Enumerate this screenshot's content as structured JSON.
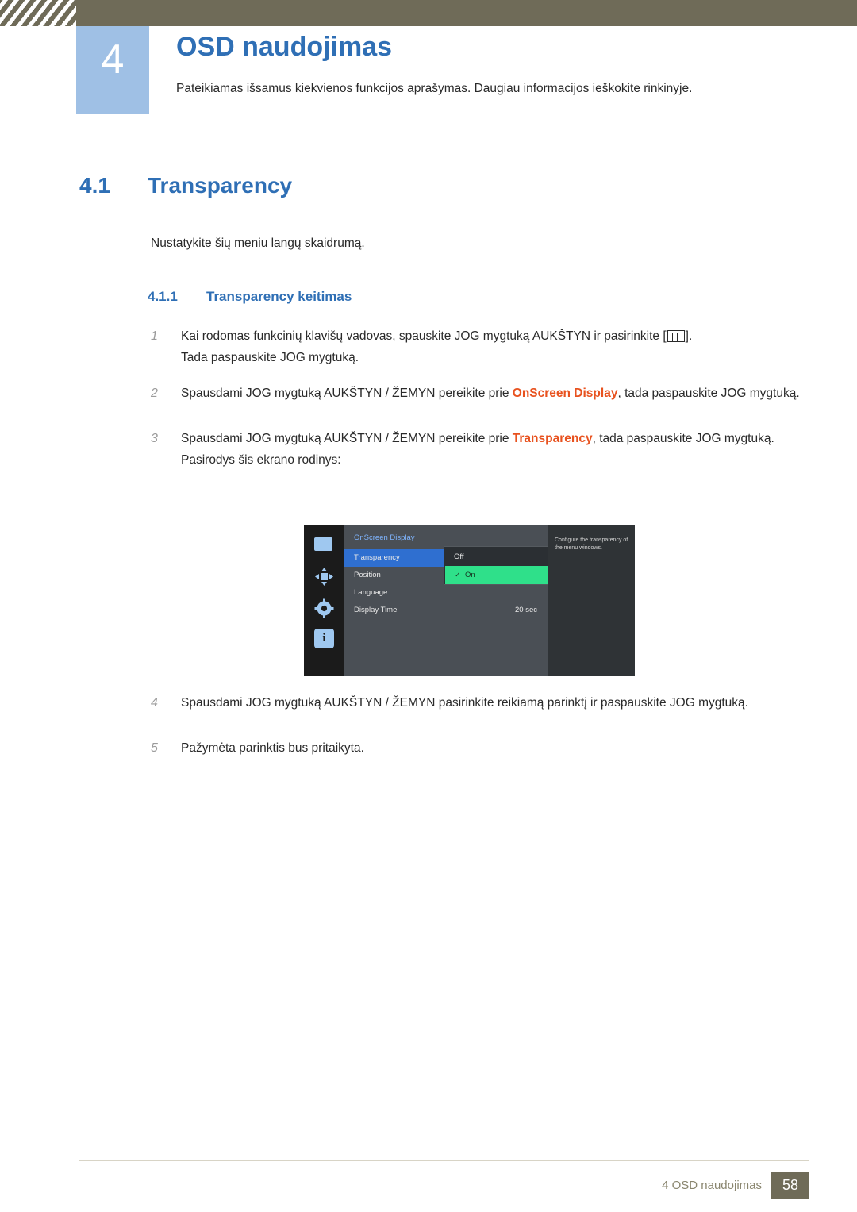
{
  "header": {
    "chapter_number": "4",
    "title": "OSD naudojimas",
    "subtitle": "Pateikiamas išsamus kiekvienos funkcijos aprašymas. Daugiau informacijos ieškokite rinkinyje."
  },
  "section": {
    "number": "4.1",
    "title": "Transparency",
    "intro": "Nustatykite šių meniu langų skaidrumą."
  },
  "subsection": {
    "number": "4.1.1",
    "title": "Transparency keitimas"
  },
  "steps": [
    {
      "marker": "1",
      "text_before": "Kai rodomas funkcinių klavišų vadovas, spauskite JOG mygtuką AUKŠTYN ir pasirinkite [",
      "text_after": "].",
      "line2": "Tada paspauskite JOG mygtuką."
    },
    {
      "marker": "2",
      "text_before": "Spausdami JOG mygtuką AUKŠTYN / ŽEMYN pereikite prie ",
      "highlight": "OnScreen Display",
      "text_after": ", tada paspauskite JOG mygtuką."
    },
    {
      "marker": "3",
      "text_before": "Spausdami JOG mygtuką AUKŠTYN / ŽEMYN pereikite prie ",
      "highlight": "Transparency",
      "text_after": ", tada paspauskite JOG mygtuką.",
      "line2": "Pasirodys šis ekrano rodinys:"
    },
    {
      "marker": "4",
      "text_before": "Spausdami JOG mygtuką AUKŠTYN / ŽEMYN pasirinkite reikiamą parinktį ir paspauskite JOG mygtuką."
    },
    {
      "marker": "5",
      "text_before": "Pažymėta parinktis bus pritaikyta."
    }
  ],
  "osd": {
    "menu_title": "OnScreen Display",
    "rows": [
      {
        "label": "Transparency",
        "value": "",
        "selected": true
      },
      {
        "label": "Position",
        "value": "",
        "selected": false
      },
      {
        "label": "Language",
        "value": "",
        "selected": false
      },
      {
        "label": "Display Time",
        "value": "20 sec",
        "selected": false
      }
    ],
    "popup": {
      "option_off": "Off",
      "option_on": "On",
      "check_mark": "✓"
    },
    "description": "Configure the transparency of the menu windows.",
    "info_icon_char": "i"
  },
  "footer": {
    "text": "4 OSD naudojimas",
    "page": "58"
  },
  "colors": {
    "accent_blue": "#2f6fb5",
    "highlight_orange": "#e8521f",
    "header_band": "#6f6b58",
    "chapter_box": "#9fc0e5",
    "osd_select": "#2f6fd0",
    "osd_on": "#2fe08a"
  }
}
